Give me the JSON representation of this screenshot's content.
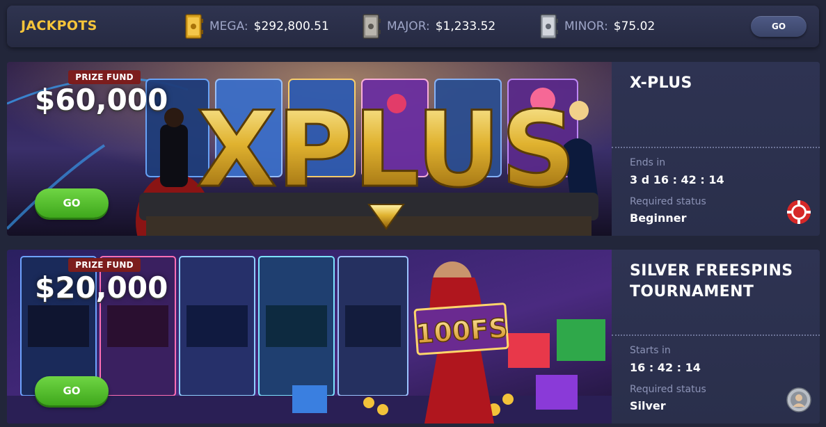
{
  "jackpots": {
    "title": "JACKPOTS",
    "items": [
      {
        "name": "MEGA:",
        "value": "$292,800.51",
        "icon": "gold-safe-icon"
      },
      {
        "name": "MAJOR:",
        "value": "$1,233.52",
        "icon": "steel-safe-icon"
      },
      {
        "name": "MINOR:",
        "value": "$75.02",
        "icon": "silver-safe-icon"
      }
    ],
    "go_label": "GO"
  },
  "tournaments": [
    {
      "title_lines": [
        "X-PLUS"
      ],
      "prize_label": "PRIZE FUND",
      "prize_amount": "$60,000",
      "banner_logo": "XPLUS",
      "go_label": "GO",
      "time_label": "Ends in",
      "time_value": "3 d 16 : 42 : 14",
      "status_label": "Required status",
      "status_value": "Beginner",
      "status_icon": "red-poker-chip-icon"
    },
    {
      "title_lines": [
        "SILVER FREESPINS",
        "TOURNAMENT"
      ],
      "prize_label": "PRIZE FUND",
      "prize_amount": "$20,000",
      "banner_sign": "100FS",
      "go_label": "GO",
      "time_label": "Starts in",
      "time_value": "16 : 42 : 14",
      "status_label": "Required status",
      "status_value": "Silver",
      "status_icon": "silver-avatar-badge-icon"
    }
  ],
  "colors": {
    "accent_gold": "#f6c53a",
    "go_green": "#4fbf2a",
    "prize_badge": "#7c1d1d",
    "background": "#22263a"
  }
}
